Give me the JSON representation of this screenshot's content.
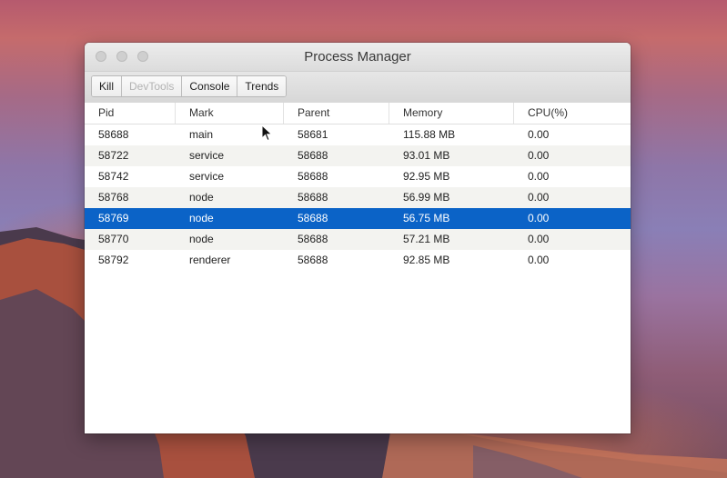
{
  "window": {
    "title": "Process Manager"
  },
  "toolbar": {
    "buttons": [
      {
        "label": "Kill",
        "enabled": true
      },
      {
        "label": "DevTools",
        "enabled": false
      },
      {
        "label": "Console",
        "enabled": true
      },
      {
        "label": "Trends",
        "enabled": true
      }
    ]
  },
  "table": {
    "columns": [
      "Pid",
      "Mark",
      "Parent",
      "Memory",
      "CPU(%)"
    ],
    "rows": [
      [
        "58688",
        "main",
        "58681",
        "115.88 MB",
        "0.00"
      ],
      [
        "58722",
        "service",
        "58688",
        "93.01 MB",
        "0.00"
      ],
      [
        "58742",
        "service",
        "58688",
        "92.95 MB",
        "0.00"
      ],
      [
        "58768",
        "node",
        "58688",
        "56.99 MB",
        "0.00"
      ],
      [
        "58769",
        "node",
        "58688",
        "56.75 MB",
        "0.00"
      ],
      [
        "58770",
        "node",
        "58688",
        "57.21 MB",
        "0.00"
      ],
      [
        "58792",
        "renderer",
        "58688",
        "92.85 MB",
        "0.00"
      ]
    ],
    "selected_row": 4
  },
  "colors": {
    "selection": "#0b63c7"
  }
}
